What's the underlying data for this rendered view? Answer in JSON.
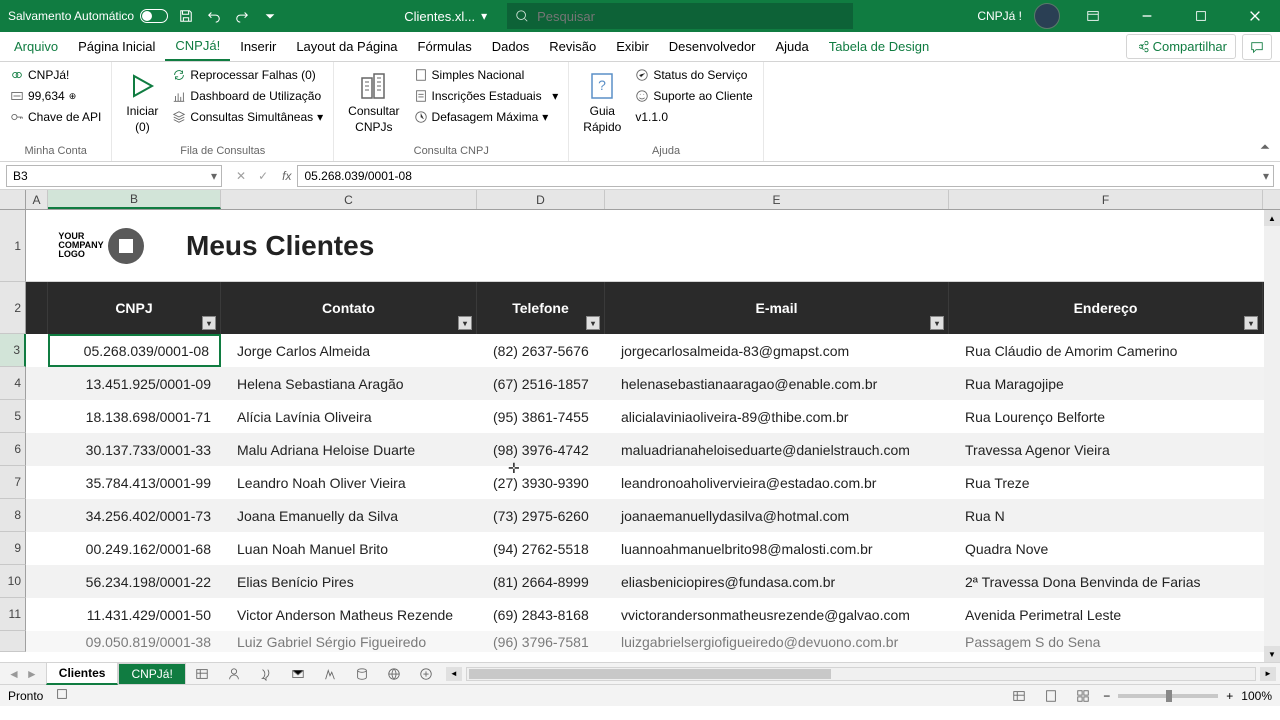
{
  "titlebar": {
    "autosave_label": "Salvamento Automático",
    "filename": "Clientes.xl...",
    "search_placeholder": "Pesquisar",
    "username": "CNPJá !"
  },
  "tabs": {
    "file": "Arquivo",
    "home": "Página Inicial",
    "cnpja": "CNPJá!",
    "insert": "Inserir",
    "pagelayout": "Layout da Página",
    "formulas": "Fórmulas",
    "data": "Dados",
    "review": "Revisão",
    "view": "Exibir",
    "developer": "Desenvolvedor",
    "help": "Ajuda",
    "design": "Tabela de Design",
    "share": "Compartilhar"
  },
  "ribbon": {
    "account": {
      "cnpja": "CNPJá!",
      "credits": "99,634",
      "apikey": "Chave de API",
      "label": "Minha Conta"
    },
    "queue": {
      "start": "Iniciar",
      "start_count": "(0)",
      "reprocess": "Reprocessar Falhas (0)",
      "dashboard": "Dashboard de Utilização",
      "simultaneous": "Consultas Simultâneas",
      "label": "Fila de Consultas"
    },
    "query": {
      "consult": "Consultar",
      "consult2": "CNPJs",
      "simples": "Simples Nacional",
      "inscricoes": "Inscrições Estaduais",
      "defasagem": "Defasagem Máxima",
      "label": "Consulta CNPJ"
    },
    "help": {
      "quick": "Guia",
      "quick2": "Rápido",
      "status": "Status do Serviço",
      "support": "Suporte ao Cliente",
      "version": "v1.1.0",
      "label": "Ajuda"
    }
  },
  "formula": {
    "namebox": "B3",
    "value": "05.268.039/0001-08"
  },
  "columns": {
    "a": "A",
    "b": "B",
    "c": "C",
    "d": "D",
    "e": "E",
    "f": "F"
  },
  "sheet": {
    "title": "Meus Clientes",
    "headers": {
      "cnpj": "CNPJ",
      "contato": "Contato",
      "telefone": "Telefone",
      "email": "E-mail",
      "endereco": "Endereço"
    },
    "rows": [
      {
        "cnpj": "05.268.039/0001-08",
        "contato": "Jorge Carlos Almeida",
        "tel": "(82) 2637-5676",
        "email": "jorgecarlosalmeida-83@gmapst.com",
        "end": "Rua Cláudio de Amorim Camerino"
      },
      {
        "cnpj": "13.451.925/0001-09",
        "contato": "Helena Sebastiana Aragão",
        "tel": "(67) 2516-1857",
        "email": "helenasebastianaaragao@enable.com.br",
        "end": "Rua Maragojipe"
      },
      {
        "cnpj": "18.138.698/0001-71",
        "contato": "Alícia Lavínia Oliveira",
        "tel": "(95) 3861-7455",
        "email": "alicialaviniaoliveira-89@thibe.com.br",
        "end": "Rua Lourenço Belforte"
      },
      {
        "cnpj": "30.137.733/0001-33",
        "contato": "Malu Adriana Heloise Duarte",
        "tel": "(98) 3976-4742",
        "email": "maluadrianaheloiseduarte@danielstrauch.com",
        "end": "Travessa Agenor Vieira"
      },
      {
        "cnpj": "35.784.413/0001-99",
        "contato": "Leandro Noah Oliver Vieira",
        "tel": "(27) 3930-9390",
        "email": "leandronoaholivervieira@estadao.com.br",
        "end": "Rua Treze"
      },
      {
        "cnpj": "34.256.402/0001-73",
        "contato": "Joana Emanuelly da Silva",
        "tel": "(73) 2975-6260",
        "email": "joanaemanuellydasilva@hotmal.com",
        "end": "Rua N"
      },
      {
        "cnpj": "00.249.162/0001-68",
        "contato": "Luan Noah Manuel Brito",
        "tel": "(94) 2762-5518",
        "email": "luannoahmanuelbrito98@malosti.com.br",
        "end": "Quadra Nove"
      },
      {
        "cnpj": "56.234.198/0001-22",
        "contato": "Elias Benício Pires",
        "tel": "(81) 2664-8999",
        "email": "eliasbeniciopires@fundasa.com.br",
        "end": "2ª Travessa Dona Benvinda de Farias"
      },
      {
        "cnpj": "11.431.429/0001-50",
        "contato": "Victor Anderson Matheus Rezende",
        "tel": "(69) 2843-8168",
        "email": "vvictorandersonmatheusrezende@galvao.com",
        "end": "Avenida Perimetral Leste"
      },
      {
        "cnpj": "09.050.819/0001-38",
        "contato": "Luiz Gabriel Sérgio Figueiredo",
        "tel": "(96) 3796-7581",
        "email": "luizgabrielsergiofigueiredo@devuono.com.br",
        "end": "Passagem S do Sena"
      }
    ]
  },
  "sheettabs": {
    "clientes": "Clientes",
    "cnpja": "CNPJá!"
  },
  "statusbar": {
    "ready": "Pronto",
    "zoom": "100%"
  },
  "logo": {
    "line1": "YOUR",
    "line2": "COMPANY",
    "line3": "LOGO"
  }
}
